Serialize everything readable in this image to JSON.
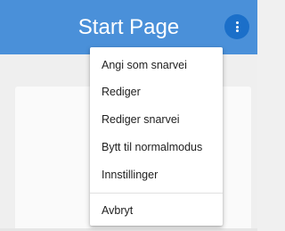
{
  "header": {
    "title": "Start Page",
    "menu_icon": "more-vert-icon"
  },
  "menu": {
    "items": [
      "Angi som snarvei",
      "Rediger",
      "Rediger snarvei",
      "Bytt til normalmodus",
      "Innstillinger"
    ],
    "cancel_label": "Avbryt"
  },
  "colors": {
    "header_bg": "#4a90d9",
    "menu_button_bg": "#1b6fc9",
    "page_bg": "#efefef",
    "menu_text": "#212121"
  }
}
